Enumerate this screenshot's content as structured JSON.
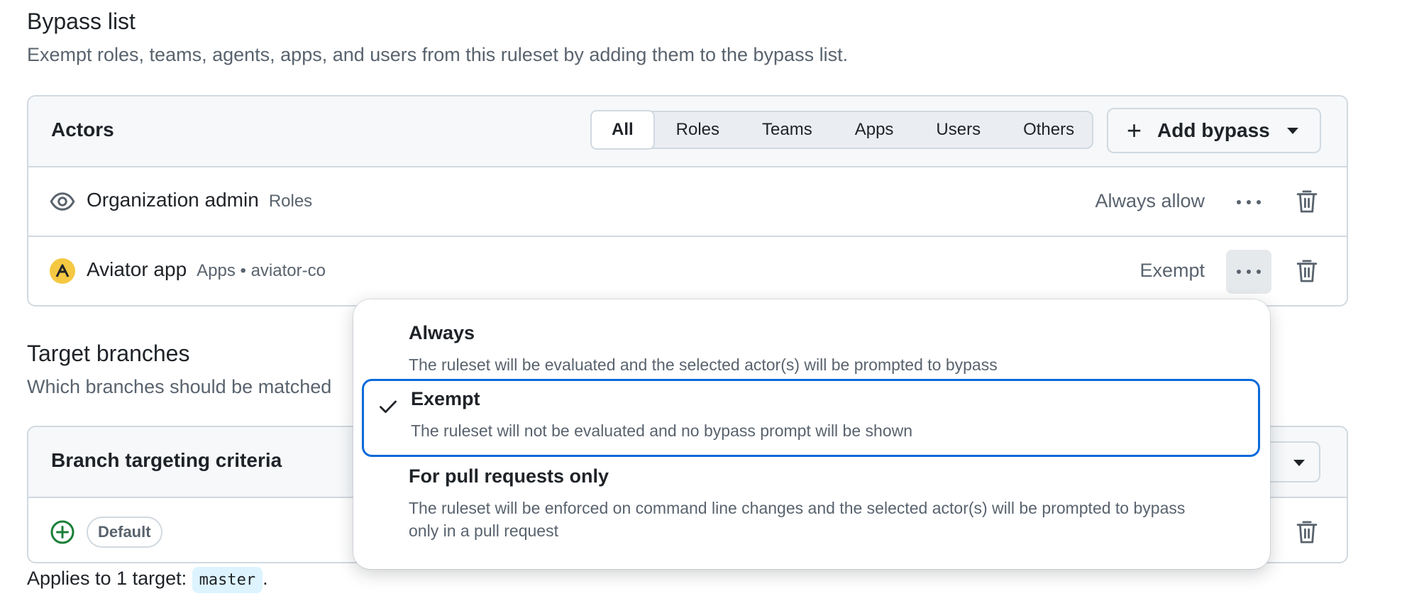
{
  "bypass": {
    "title": "Bypass list",
    "description": "Exempt roles, teams, agents, apps, and users from this ruleset by adding them to the bypass list.",
    "header_title": "Actors",
    "filters": [
      "All",
      "Roles",
      "Teams",
      "Apps",
      "Users",
      "Others"
    ],
    "active_filter": "All",
    "add_button": "Add bypass",
    "rows": [
      {
        "name": "Organization admin",
        "meta": "Roles",
        "mode": "Always allow",
        "icon": "eye-icon"
      },
      {
        "name": "Aviator app",
        "meta": "Apps • aviator-co",
        "mode": "Exempt",
        "icon": "aviator-app-icon"
      }
    ]
  },
  "target": {
    "title": "Target branches",
    "description": "Which branches should be matched",
    "header_title": "Branch targeting criteria",
    "criteria": [
      {
        "label": "Default"
      }
    ],
    "applies_prefix": "Applies to 1 target:",
    "applies_target": "master",
    "applies_suffix": "."
  },
  "dropdown": {
    "options": [
      {
        "label": "Always",
        "description": "The ruleset will be evaluated and the selected actor(s) will be prompted to bypass",
        "selected": false
      },
      {
        "label": "Exempt",
        "description": "The ruleset will not be evaluated and no bypass prompt will be shown",
        "selected": true
      },
      {
        "label": "For pull requests only",
        "description": "The ruleset will be enforced on command line changes and the selected actor(s) will be prompted to bypass only in a pull request",
        "selected": false
      }
    ]
  },
  "colors": {
    "accent": "#0969da",
    "border": "#d1d9e0",
    "muted_text": "#59636e",
    "aviator_badge": "#f5c842",
    "add_icon_green": "#1a7f37",
    "code_bg": "#ddf4ff"
  }
}
